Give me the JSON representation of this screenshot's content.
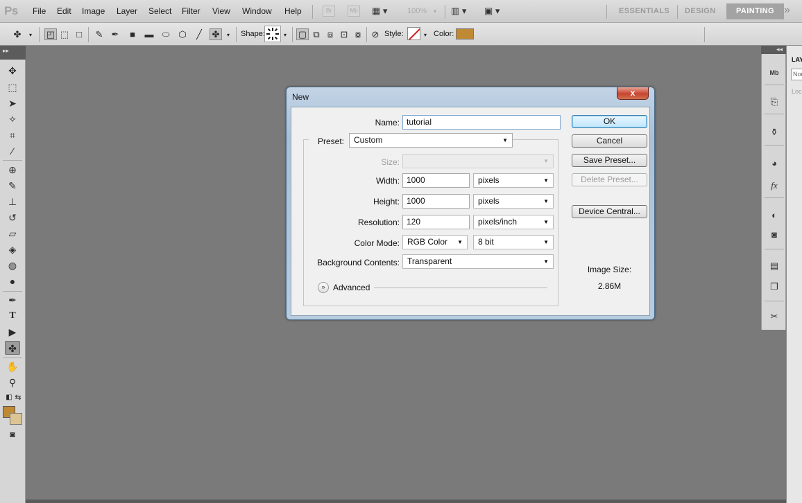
{
  "menubar": {
    "logo": "Ps",
    "items": [
      "File",
      "Edit",
      "Image",
      "Layer",
      "Select",
      "Filter",
      "View",
      "Window",
      "Help"
    ],
    "bridge": "Br",
    "minibridge": "Mb",
    "zoom": "100%",
    "workspaces": {
      "essentials": "ESSENTIALS",
      "design": "DESIGN",
      "painting": "PAINTING"
    }
  },
  "options": {
    "shape_label": "Shape:",
    "style_label": "Style:",
    "color_label": "Color:",
    "color_value": "#c08a35"
  },
  "toolbox": {
    "fg_color": "#c08a35",
    "bg_color": "#dcc592"
  },
  "layers_panel": {
    "tab": "LAY",
    "blend": "Nor",
    "lock": "Loc"
  },
  "dialog": {
    "title": "New",
    "close": "x",
    "name_label": "Name:",
    "name_value": "tutorial",
    "preset_label": "Preset:",
    "preset_value": "Custom",
    "size_label": "Size:",
    "size_value": "",
    "width_label": "Width:",
    "width_value": "1000",
    "width_unit": "pixels",
    "height_label": "Height:",
    "height_value": "1000",
    "height_unit": "pixels",
    "resolution_label": "Resolution:",
    "resolution_value": "120",
    "resolution_unit": "pixels/inch",
    "colormode_label": "Color Mode:",
    "colormode_value": "RGB Color",
    "bitdepth_value": "8 bit",
    "bgcontents_label": "Background Contents:",
    "bgcontents_value": "Transparent",
    "advanced_label": "Advanced",
    "buttons": {
      "ok": "OK",
      "cancel": "Cancel",
      "save_preset": "Save Preset...",
      "delete_preset": "Delete Preset...",
      "device_central": "Device Central..."
    },
    "image_size_label": "Image Size:",
    "image_size_value": "2.86M"
  }
}
